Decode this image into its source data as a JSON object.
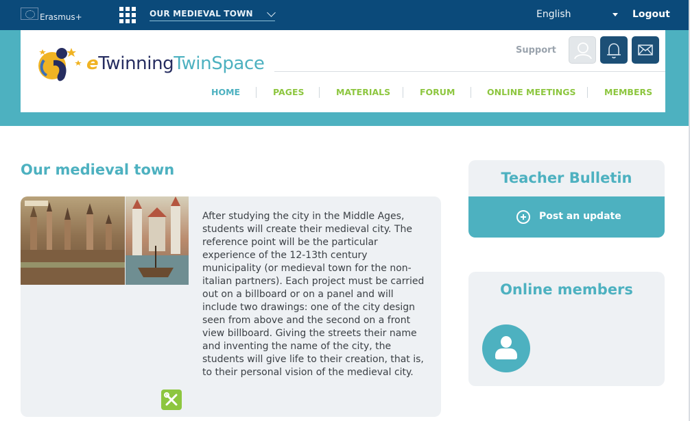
{
  "topbar": {
    "program": "Erasmus+",
    "project_menu": "OUR MEDIEVAL TOWN",
    "language": "English",
    "logout": "Logout"
  },
  "header": {
    "logo_e": "e",
    "logo_twinning": "Twinning",
    "logo_twinspace": "TwinSpace",
    "support": "Support",
    "icons": {
      "user": "user-icon",
      "bell": "bell-icon",
      "mail": "mail-icon",
      "apps": "grid-icon"
    },
    "nav": [
      {
        "label": "HOME"
      },
      {
        "label": "PAGES"
      },
      {
        "label": "MATERIALS"
      },
      {
        "label": "FORUM"
      },
      {
        "label": "ONLINE MEETINGS"
      },
      {
        "label": "MEMBERS"
      }
    ]
  },
  "main": {
    "title": "Our medieval town",
    "description": "After studying the city in the Middle Ages, students will create their medieval city. The reference point will be the particular experience of the 12-13th century municipality (or medieval town for the non-italian partners). Each project must be carried out on a billboard or on a panel and will include two drawings: one of the city design seen from above and the second on a front view billboard. Giving the streets their name and inventing the name of the city, the students will give life to their creation, that is, to their personal vision of the medieval city."
  },
  "sidebar": {
    "bulletin_title": "Teacher Bulletin",
    "post_update": "Post an update",
    "online_title": "Online members"
  },
  "colors": {
    "topbar": "#0b4a7a",
    "accent_teal": "#4db1c0",
    "nav_active": "#4db1c0",
    "nav_green": "#8dc63f",
    "card_bg": "#eef1f4"
  }
}
